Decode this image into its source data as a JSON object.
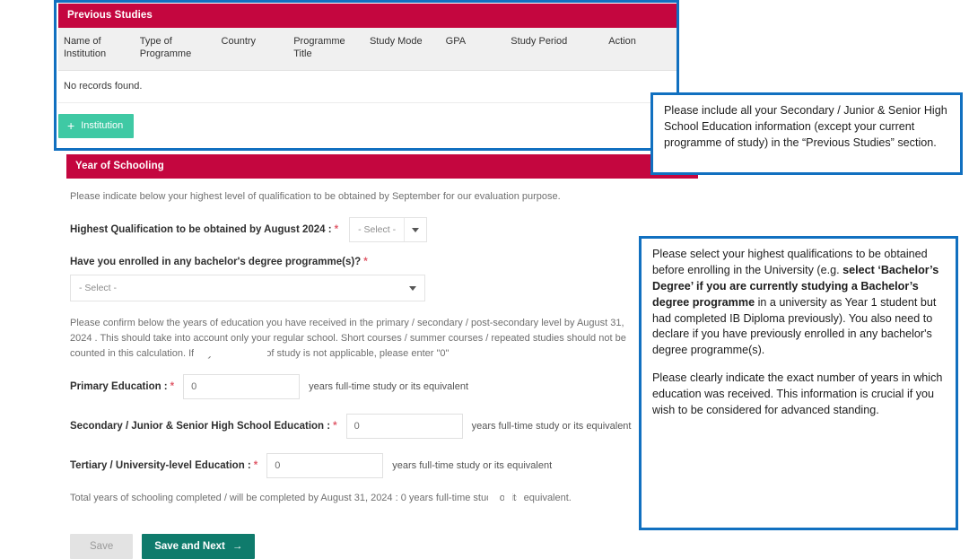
{
  "previous_studies": {
    "section_title": "Previous Studies",
    "columns": [
      "Name of Institution",
      "Type of Programme",
      "Country",
      "Programme Title",
      "Study Mode",
      "GPA",
      "Study Period",
      "Action"
    ],
    "empty_message": "No records found.",
    "add_button": {
      "label": "Institution",
      "plus_icon": "plus-icon",
      "color": "#3fc9a4"
    }
  },
  "year_of_schooling": {
    "section_title": "Year of Schooling",
    "intro": "Please indicate below your highest level of qualification to be obtained by September for our evaluation purpose.",
    "highest_qualification": {
      "label": "Highest Qualification to be obtained by August 2024 :",
      "required_marker": "*",
      "value": "- Select -"
    },
    "bachelor_enrolled": {
      "label": "Have you enrolled in any bachelor's degree programme(s)?",
      "required_marker": "*",
      "value": "- Select -"
    },
    "confirm_note": "Please confirm below the years of education you have received in the primary / secondary / post-secondary level by August 31, 2024 . This should take into account only your regular school. Short courses / summer courses / repeated studies should not be counted in this calculation. If any of the level of study is not applicable, please enter \"0\"",
    "rows": [
      {
        "label": "Primary Education  :",
        "required_marker": "*",
        "value": "0",
        "suffix": "years full-time study or its equivalent"
      },
      {
        "label": "Secondary / Junior & Senior High School Education  :",
        "required_marker": "*",
        "value": "0",
        "suffix": "years full-time study or its equivalent"
      },
      {
        "label": "Tertiary / University-level Education  :",
        "required_marker": "*",
        "value": "0",
        "suffix": "years full-time study or its equivalent"
      }
    ],
    "total_line": "Total years of schooling completed / will be completed by August 31, 2024  :  0 years full-time study or its equivalent.",
    "buttons": {
      "save_label": "Save",
      "save_next_label": "Save and Next",
      "save_next_arrow": "arrow-right-icon",
      "save_next_color": "#0f7b6c"
    }
  },
  "annotations": {
    "highlight_color": "#1170c0",
    "callout_1": {
      "text": "Please include all your Secondary / Junior & Senior High School Education information (except your current programme of study) in the “Previous Studies” section."
    },
    "callout_2": {
      "p1_a": "Please select your highest qualifications to be obtained before enrolling in the University (e.g. ",
      "p1_b": "select ‘Bachelor’s Degree’ if you are currently studying a Bachelor’s degree programme",
      "p1_c": " in a university as Year 1 student but had completed IB Diploma previously). You also need to declare if you have previously enrolled in any bachelor's degree programme(s).",
      "p2": "Please clearly indicate the exact number of years in which education was received. This information is crucial if you wish to be considered for advanced standing."
    }
  },
  "theme": {
    "section_bar_color": "#c4063f"
  }
}
